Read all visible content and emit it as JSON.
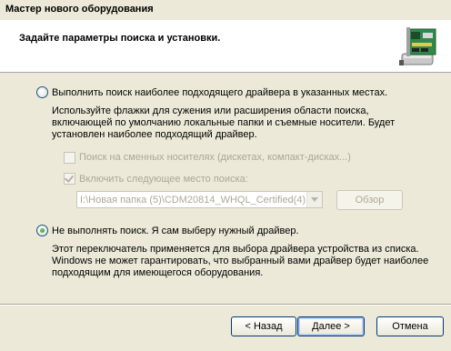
{
  "window": {
    "title": "Мастер нового оборудования"
  },
  "header": {
    "title": "Задайте параметры поиска и установки.",
    "icon": "hardware-card-icon"
  },
  "option_search": {
    "label": "Выполнить поиск наиболее подходящего драйвера в указанных местах.",
    "selected": false,
    "description": "Используйте флажки для сужения или расширения области поиска, включающей по умолчанию локальные папки и съемные носители. Будет установлен наиболее подходящий драйвер.",
    "removable_media": {
      "label": "Поиск на сменных носителях (дискетах, компакт-дисках...)",
      "checked": false,
      "enabled": false
    },
    "include_location": {
      "label": "Включить следующее место поиска:",
      "checked": true,
      "enabled": false
    },
    "location_value": "I:\\Новая папка (5)\\CDM20814_WHQL_Certified(4)",
    "browse_label": "Обзор"
  },
  "option_manual": {
    "label": "Не выполнять поиск. Я сам выберу нужный драйвер.",
    "selected": true,
    "description": "Этот переключатель применяется для выбора драйвера устройства из списка. Windows не может гарантировать, что выбранный вами драйвер будет наиболее подходящим для имеющегося оборудования."
  },
  "buttons": {
    "back": "< Назад",
    "next": "Далее >",
    "cancel": "Отмена"
  }
}
